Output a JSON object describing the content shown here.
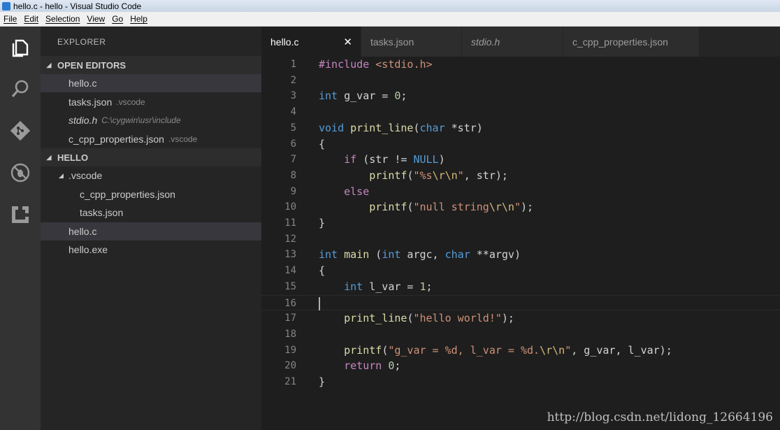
{
  "window": {
    "title": "hello.c - hello - Visual Studio Code"
  },
  "menu": [
    "File",
    "Edit",
    "Selection",
    "View",
    "Go",
    "Help"
  ],
  "activity": [
    {
      "icon": "files-icon"
    },
    {
      "icon": "search-icon"
    },
    {
      "icon": "git-icon"
    },
    {
      "icon": "debug-icon"
    },
    {
      "icon": "extensions-icon"
    }
  ],
  "sidebar": {
    "title": "EXPLORER",
    "open_editors_label": "OPEN EDITORS",
    "open_editors": [
      {
        "name": "hello.c",
        "desc": ""
      },
      {
        "name": "tasks.json",
        "desc": ".vscode"
      },
      {
        "name": "stdio.h",
        "desc": "C:\\cygwin\\usr\\include"
      },
      {
        "name": "c_cpp_properties.json",
        "desc": ".vscode"
      }
    ],
    "project_label": "HELLO",
    "tree": [
      {
        "name": ".vscode"
      },
      {
        "name": "c_cpp_properties.json"
      },
      {
        "name": "tasks.json"
      },
      {
        "name": "hello.c"
      },
      {
        "name": "hello.exe"
      }
    ]
  },
  "tabs": [
    {
      "label": "hello.c",
      "close": "✕"
    },
    {
      "label": "tasks.json"
    },
    {
      "label": "stdio.h"
    },
    {
      "label": "c_cpp_properties.json"
    }
  ],
  "editor": {
    "line_numbers": [
      "1",
      "2",
      "3",
      "4",
      "5",
      "6",
      "7",
      "8",
      "9",
      "10",
      "11",
      "12",
      "13",
      "14",
      "15",
      "16",
      "17",
      "18",
      "19",
      "20",
      "21"
    ],
    "lines": [
      [
        [
          "pp",
          "#include "
        ],
        [
          "str",
          "<stdio.h>"
        ]
      ],
      [],
      [
        [
          "kw",
          "int"
        ],
        [
          "txt",
          " g_var = "
        ],
        [
          "num",
          "0"
        ],
        [
          "txt",
          ";"
        ]
      ],
      [],
      [
        [
          "kw",
          "void"
        ],
        [
          "txt",
          " "
        ],
        [
          "fn",
          "print_line"
        ],
        [
          "txt",
          "("
        ],
        [
          "kw",
          "char"
        ],
        [
          "txt",
          " *str)"
        ]
      ],
      [
        [
          "txt",
          "{"
        ]
      ],
      [
        [
          "txt",
          "    "
        ],
        [
          "ctl",
          "if"
        ],
        [
          "txt",
          " (str != "
        ],
        [
          "kw",
          "NULL"
        ],
        [
          "txt",
          ")"
        ]
      ],
      [
        [
          "txt",
          "        "
        ],
        [
          "fn",
          "printf"
        ],
        [
          "txt",
          "("
        ],
        [
          "str",
          "\"%s"
        ],
        [
          "esc",
          "\\r\\n"
        ],
        [
          "str",
          "\""
        ],
        [
          "txt",
          ", str);"
        ]
      ],
      [
        [
          "txt",
          "    "
        ],
        [
          "ctl",
          "else"
        ]
      ],
      [
        [
          "txt",
          "        "
        ],
        [
          "fn",
          "printf"
        ],
        [
          "txt",
          "("
        ],
        [
          "str",
          "\"null string"
        ],
        [
          "esc",
          "\\r\\n"
        ],
        [
          "str",
          "\""
        ],
        [
          "txt",
          ");"
        ]
      ],
      [
        [
          "txt",
          "}"
        ]
      ],
      [],
      [
        [
          "kw",
          "int"
        ],
        [
          "txt",
          " "
        ],
        [
          "fn",
          "main"
        ],
        [
          "txt",
          " ("
        ],
        [
          "kw",
          "int"
        ],
        [
          "txt",
          " argc, "
        ],
        [
          "kw",
          "char"
        ],
        [
          "txt",
          " **argv)"
        ]
      ],
      [
        [
          "txt",
          "{"
        ]
      ],
      [
        [
          "txt",
          "    "
        ],
        [
          "kw",
          "int"
        ],
        [
          "txt",
          " l_var = "
        ],
        [
          "num",
          "1"
        ],
        [
          "txt",
          ";"
        ]
      ],
      [],
      [
        [
          "txt",
          "    "
        ],
        [
          "fn",
          "print_line"
        ],
        [
          "txt",
          "("
        ],
        [
          "str",
          "\"hello world!\""
        ],
        [
          "txt",
          ");"
        ]
      ],
      [],
      [
        [
          "txt",
          "    "
        ],
        [
          "fn",
          "printf"
        ],
        [
          "txt",
          "("
        ],
        [
          "str",
          "\"g_var = %d, l_var = %d."
        ],
        [
          "esc",
          "\\r\\n"
        ],
        [
          "str",
          "\""
        ],
        [
          "txt",
          ", g_var, l_var);"
        ]
      ],
      [
        [
          "txt",
          "    "
        ],
        [
          "ctl",
          "return"
        ],
        [
          "txt",
          " "
        ],
        [
          "num",
          "0"
        ],
        [
          "txt",
          ";"
        ]
      ],
      [
        [
          "txt",
          "}"
        ]
      ]
    ]
  },
  "watermark": "http://blog.csdn.net/lidong_12664196",
  "colors": {
    "accent": "#569cd6",
    "sidebar_bg": "#252526",
    "editor_bg": "#1e1e1e",
    "activity_bg": "#333333"
  }
}
